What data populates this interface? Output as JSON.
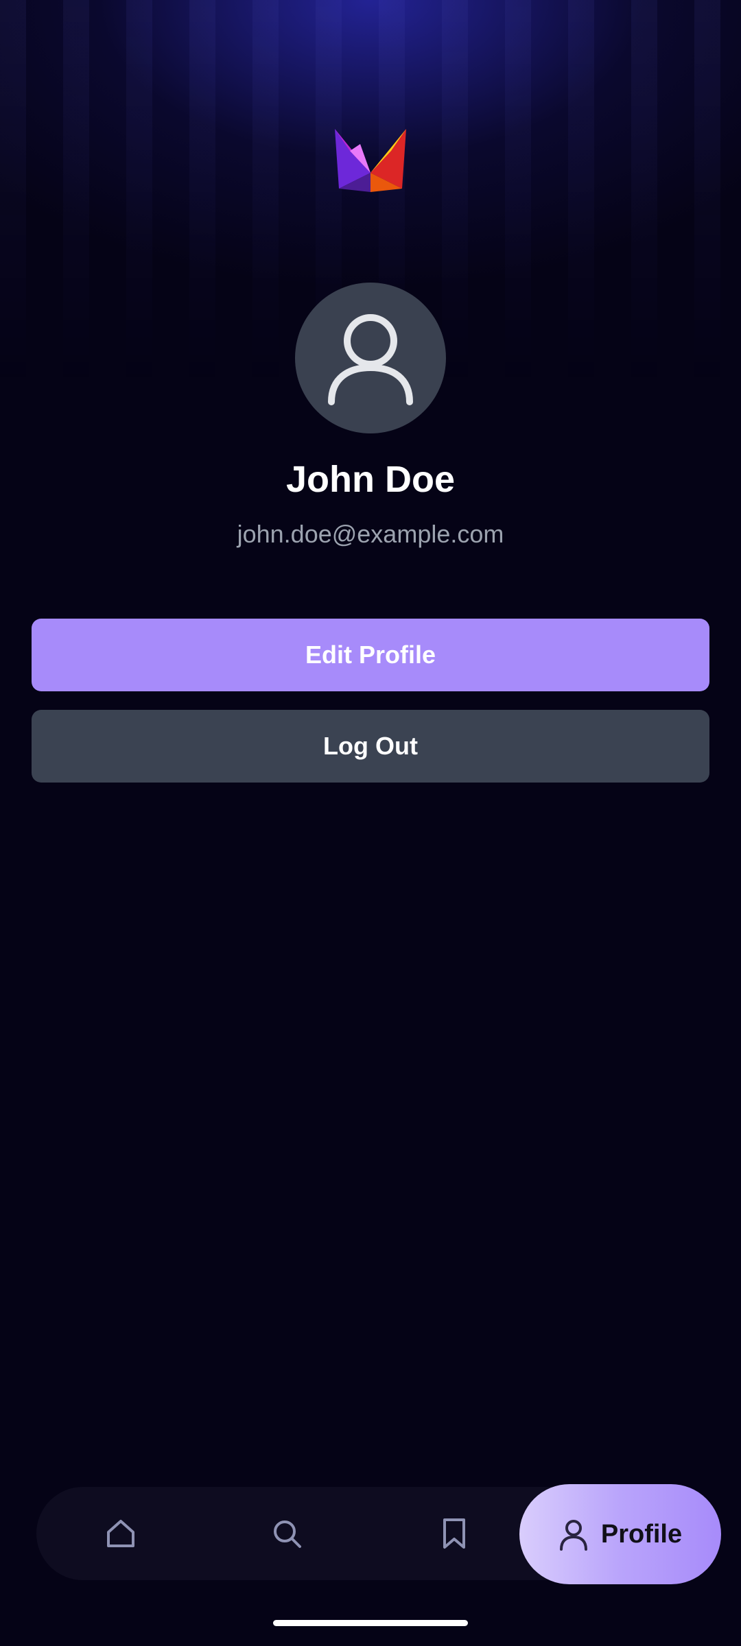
{
  "app": {
    "logo": "app-logo"
  },
  "profile": {
    "avatar_icon": "user-icon",
    "name": "John Doe",
    "email": "john.doe@example.com"
  },
  "actions": {
    "edit_label": "Edit Profile",
    "logout_label": "Log Out"
  },
  "bottom_nav": {
    "items": [
      {
        "icon": "home-icon",
        "label": ""
      },
      {
        "icon": "search-icon",
        "label": ""
      },
      {
        "icon": "bookmark-icon",
        "label": ""
      },
      {
        "icon": "user-icon",
        "label": "Profile",
        "active": true
      }
    ]
  },
  "colors": {
    "background": "#050316",
    "accent": "#a78bfa",
    "secondary_button": "#3b4352",
    "avatar_bg": "#3a4150",
    "email_text": "#9ca3af"
  }
}
